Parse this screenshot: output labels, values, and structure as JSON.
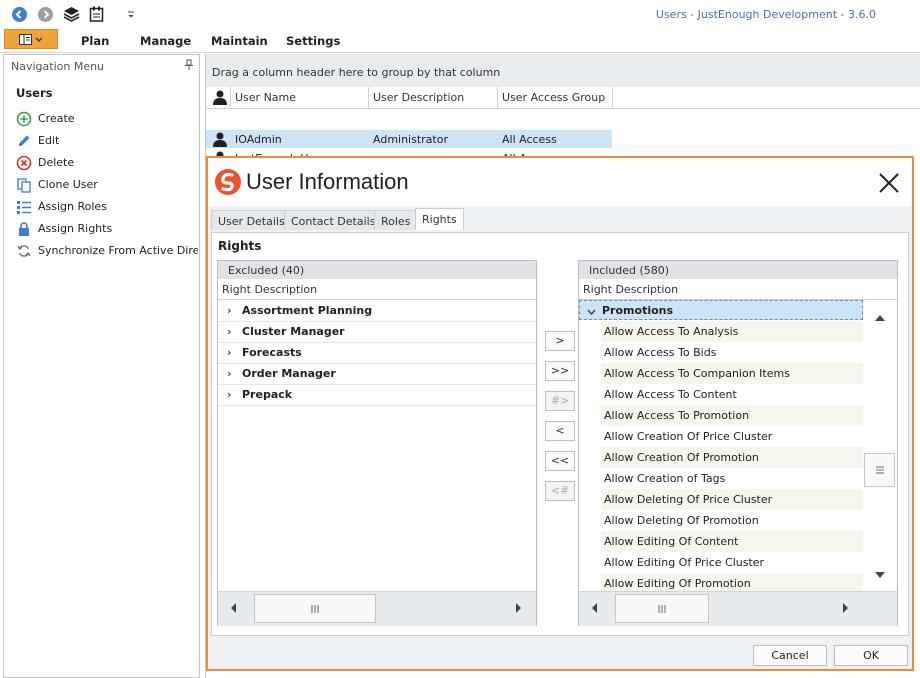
{
  "app": {
    "title": "Users - JustEnough Development - 3.6.0",
    "colors": {
      "accent": "#ef8a3c",
      "file_button": "#f2a23a",
      "selection": "#cde3f6",
      "back_button": "#3f7fd1"
    }
  },
  "toolbar": {
    "icons": [
      "back-icon",
      "forward-icon",
      "layers-icon",
      "clipboard-icon",
      "customize-icon"
    ]
  },
  "menu": {
    "items": [
      "Plan",
      "Manage",
      "Maintain",
      "Settings"
    ]
  },
  "nav": {
    "header": "Navigation Menu",
    "title": "Users",
    "pin_icon": "pin-icon",
    "items": [
      {
        "label": "Create",
        "icon": "plus-circle-icon"
      },
      {
        "label": "Edit",
        "icon": "pencil-icon"
      },
      {
        "label": "Delete",
        "icon": "delete-circle-icon"
      },
      {
        "label": "Clone User",
        "icon": "clone-icon"
      },
      {
        "label": "Assign Roles",
        "icon": "list-icon"
      },
      {
        "label": "Assign Rights",
        "icon": "lock-icon"
      },
      {
        "label": "Synchronize From Active Dire…",
        "icon": "sync-icon"
      }
    ]
  },
  "grid": {
    "group_hint": "Drag a column header here to group by that column",
    "columns": [
      "User Name",
      "User Description",
      "User Access Group"
    ],
    "rows": [
      [
        "IOAdmin",
        "Administrator",
        "All Access"
      ],
      [
        "JustEnough User",
        "",
        "All Access"
      ]
    ]
  },
  "dialog": {
    "title": "User Information",
    "tabs": [
      "User Details",
      "Contact Details",
      "Roles",
      "Rights"
    ],
    "active_tab": "Rights",
    "heading": "Rights",
    "excluded": {
      "caption": "Excluded (40)",
      "column": "Right Description",
      "items": [
        "Assortment Planning",
        "Cluster Manager",
        "Forecasts",
        "Order Manager",
        "Prepack"
      ]
    },
    "included": {
      "caption": "Included (580)",
      "column": "Right Description",
      "group": "Promotions",
      "items": [
        "Allow Access To Analysis",
        "Allow Access To Bids",
        "Allow Access To Companion Items",
        "Allow Access To Content",
        "Allow Access To Promotion",
        "Allow Creation Of Price Cluster",
        "Allow Creation Of Promotion",
        "Allow Creation of Tags",
        "Allow Deleting Of Price Cluster",
        "Allow Deleting Of Promotion",
        "Allow Editing Of Content",
        "Allow Editing Of Price Cluster",
        "Allow Editing Of Promotion"
      ]
    },
    "transfer_buttons": [
      {
        "label": ">",
        "enabled": true
      },
      {
        "label": ">>",
        "enabled": true
      },
      {
        "label": "#>",
        "enabled": false
      },
      {
        "label": "<",
        "enabled": true
      },
      {
        "label": "<<",
        "enabled": true
      },
      {
        "label": "<#",
        "enabled": false
      }
    ],
    "cancel_label": "Cancel",
    "ok_label": "OK"
  }
}
